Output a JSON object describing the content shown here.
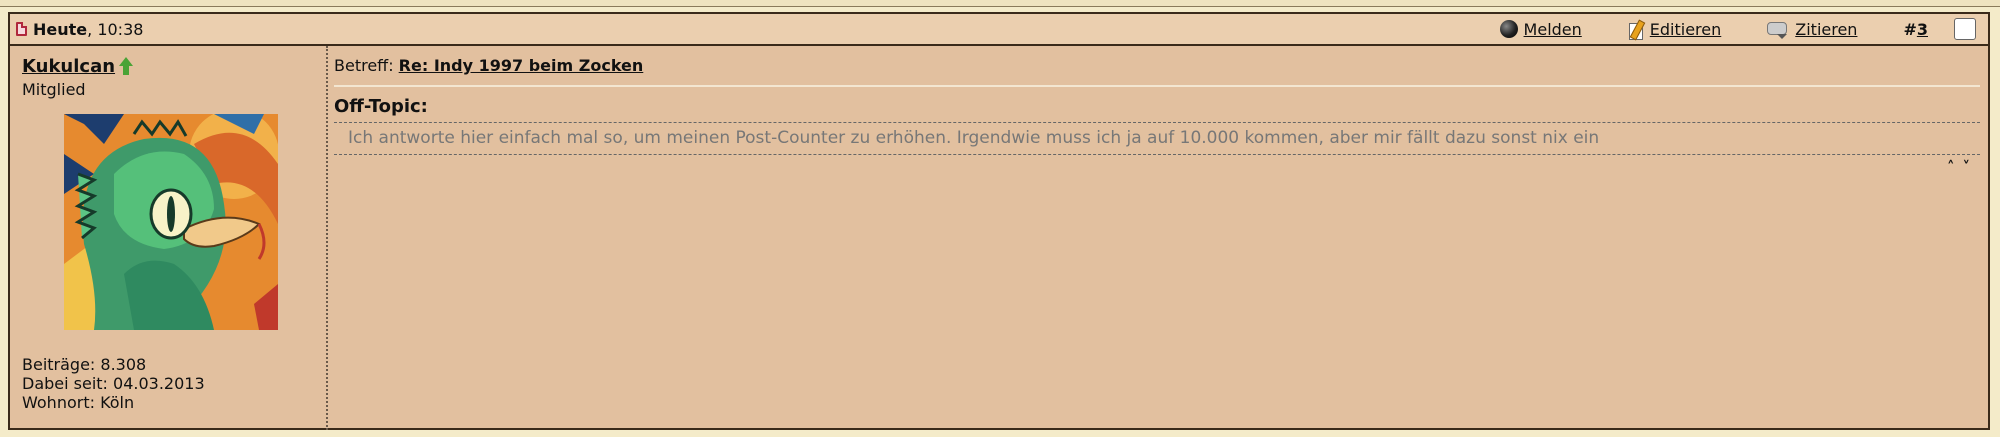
{
  "header": {
    "date_day": "Heute",
    "date_time": ", 10:38",
    "report_label": "Melden",
    "edit_label": "Editieren",
    "quote_label": "Zitieren",
    "post_hash": "#",
    "post_number": "3"
  },
  "user": {
    "name": "Kukulcan",
    "role": "Mitglied",
    "stats": [
      "Beiträge: 8.308",
      "Dabei seit: 04.03.2013",
      "Wohnort: Köln"
    ]
  },
  "post": {
    "subject_label": "Betreff:",
    "subject": "Re: Indy 1997 beim Zocken",
    "offtopic_title": "Off-Topic:",
    "offtopic_text": "Ich antworte hier einfach mal so, um meinen Post-Counter zu erhöhen. Irgendwie muss ich ja auf 10.000 kommen, aber mir fällt dazu sonst nix ein"
  },
  "nav": {
    "up": "˄",
    "down": "˅"
  },
  "icons": [
    "file-icon",
    "bomb-icon",
    "edit-pencil-icon",
    "quote-bubble-icon",
    "rank-up-arrow-icon"
  ]
}
